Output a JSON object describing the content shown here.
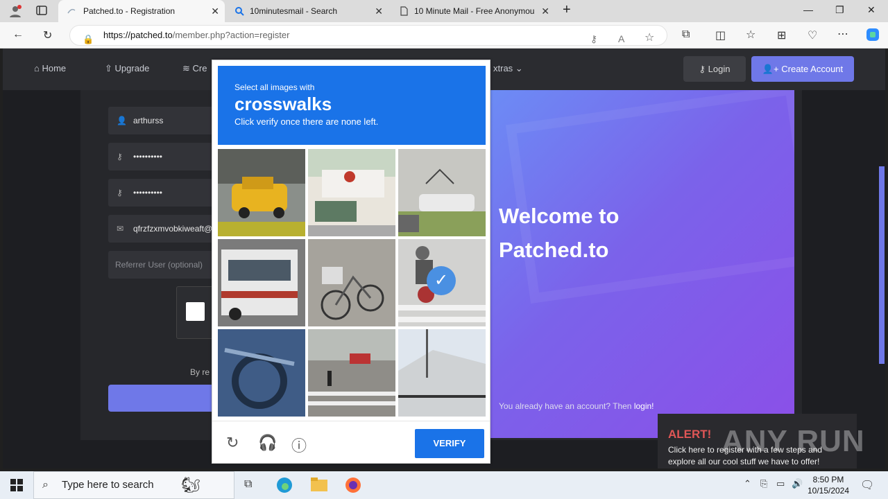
{
  "browser": {
    "tabs": [
      {
        "title": "Patched.to - Registration",
        "active": true
      },
      {
        "title": "10minutesmail - Search",
        "active": false
      },
      {
        "title": "10 Minute Mail - Free Anonymou",
        "active": false
      }
    ],
    "url_host": "https://patched.to",
    "url_path": "/member.php?action=register"
  },
  "site": {
    "nav": [
      {
        "label": "Home",
        "icon": "home-icon"
      },
      {
        "label": "Upgrade",
        "icon": "upgrade-icon"
      },
      {
        "label": "Cre",
        "icon": "credits-icon"
      },
      {
        "label": "xtras",
        "icon": "chevron-down-icon"
      }
    ],
    "login_label": "Login",
    "create_label": "Create Account"
  },
  "form": {
    "username": "arthurss",
    "password": "••••••••••",
    "confirm_password": "••••••••••",
    "email": "qfrzfzxmvobkiweaft@",
    "referrer_placeholder": "Referrer User (optional)",
    "terms_fragment": "By re"
  },
  "welcome": {
    "title": "Welcome to Patched.to",
    "have_account": "You already have an account? Then",
    "login_link": "login!"
  },
  "captcha": {
    "select_label": "Select all images with",
    "object": "crosswalks",
    "instruction": "Click verify once there are none left.",
    "verify_label": "VERIFY",
    "tiles": [
      {
        "scene": "yellow taxi on street",
        "selected": false
      },
      {
        "scene": "storefront with sign",
        "selected": false
      },
      {
        "scene": "boat on trailer in yard",
        "selected": false
      },
      {
        "scene": "city bus",
        "selected": false
      },
      {
        "scene": "parked bicycle",
        "selected": false
      },
      {
        "scene": "motorcyclist on crosswalk",
        "selected": true
      },
      {
        "scene": "motorcycle close-up",
        "selected": false
      },
      {
        "scene": "pedestrian crossing street",
        "selected": false
      },
      {
        "scene": "house with fence",
        "selected": false
      }
    ]
  },
  "alert": {
    "title": "ALERT!",
    "text": "Click here to register with a few steps and explore all our cool stuff we have to offer!"
  },
  "watermark": "ANY RUN",
  "taskbar": {
    "search_placeholder": "Type here to search",
    "time": "8:50 PM",
    "date": "10/15/2024"
  },
  "colors": {
    "accent": "#6f78e8",
    "captcha_blue": "#1a73e8",
    "alert_red": "#e05656"
  }
}
